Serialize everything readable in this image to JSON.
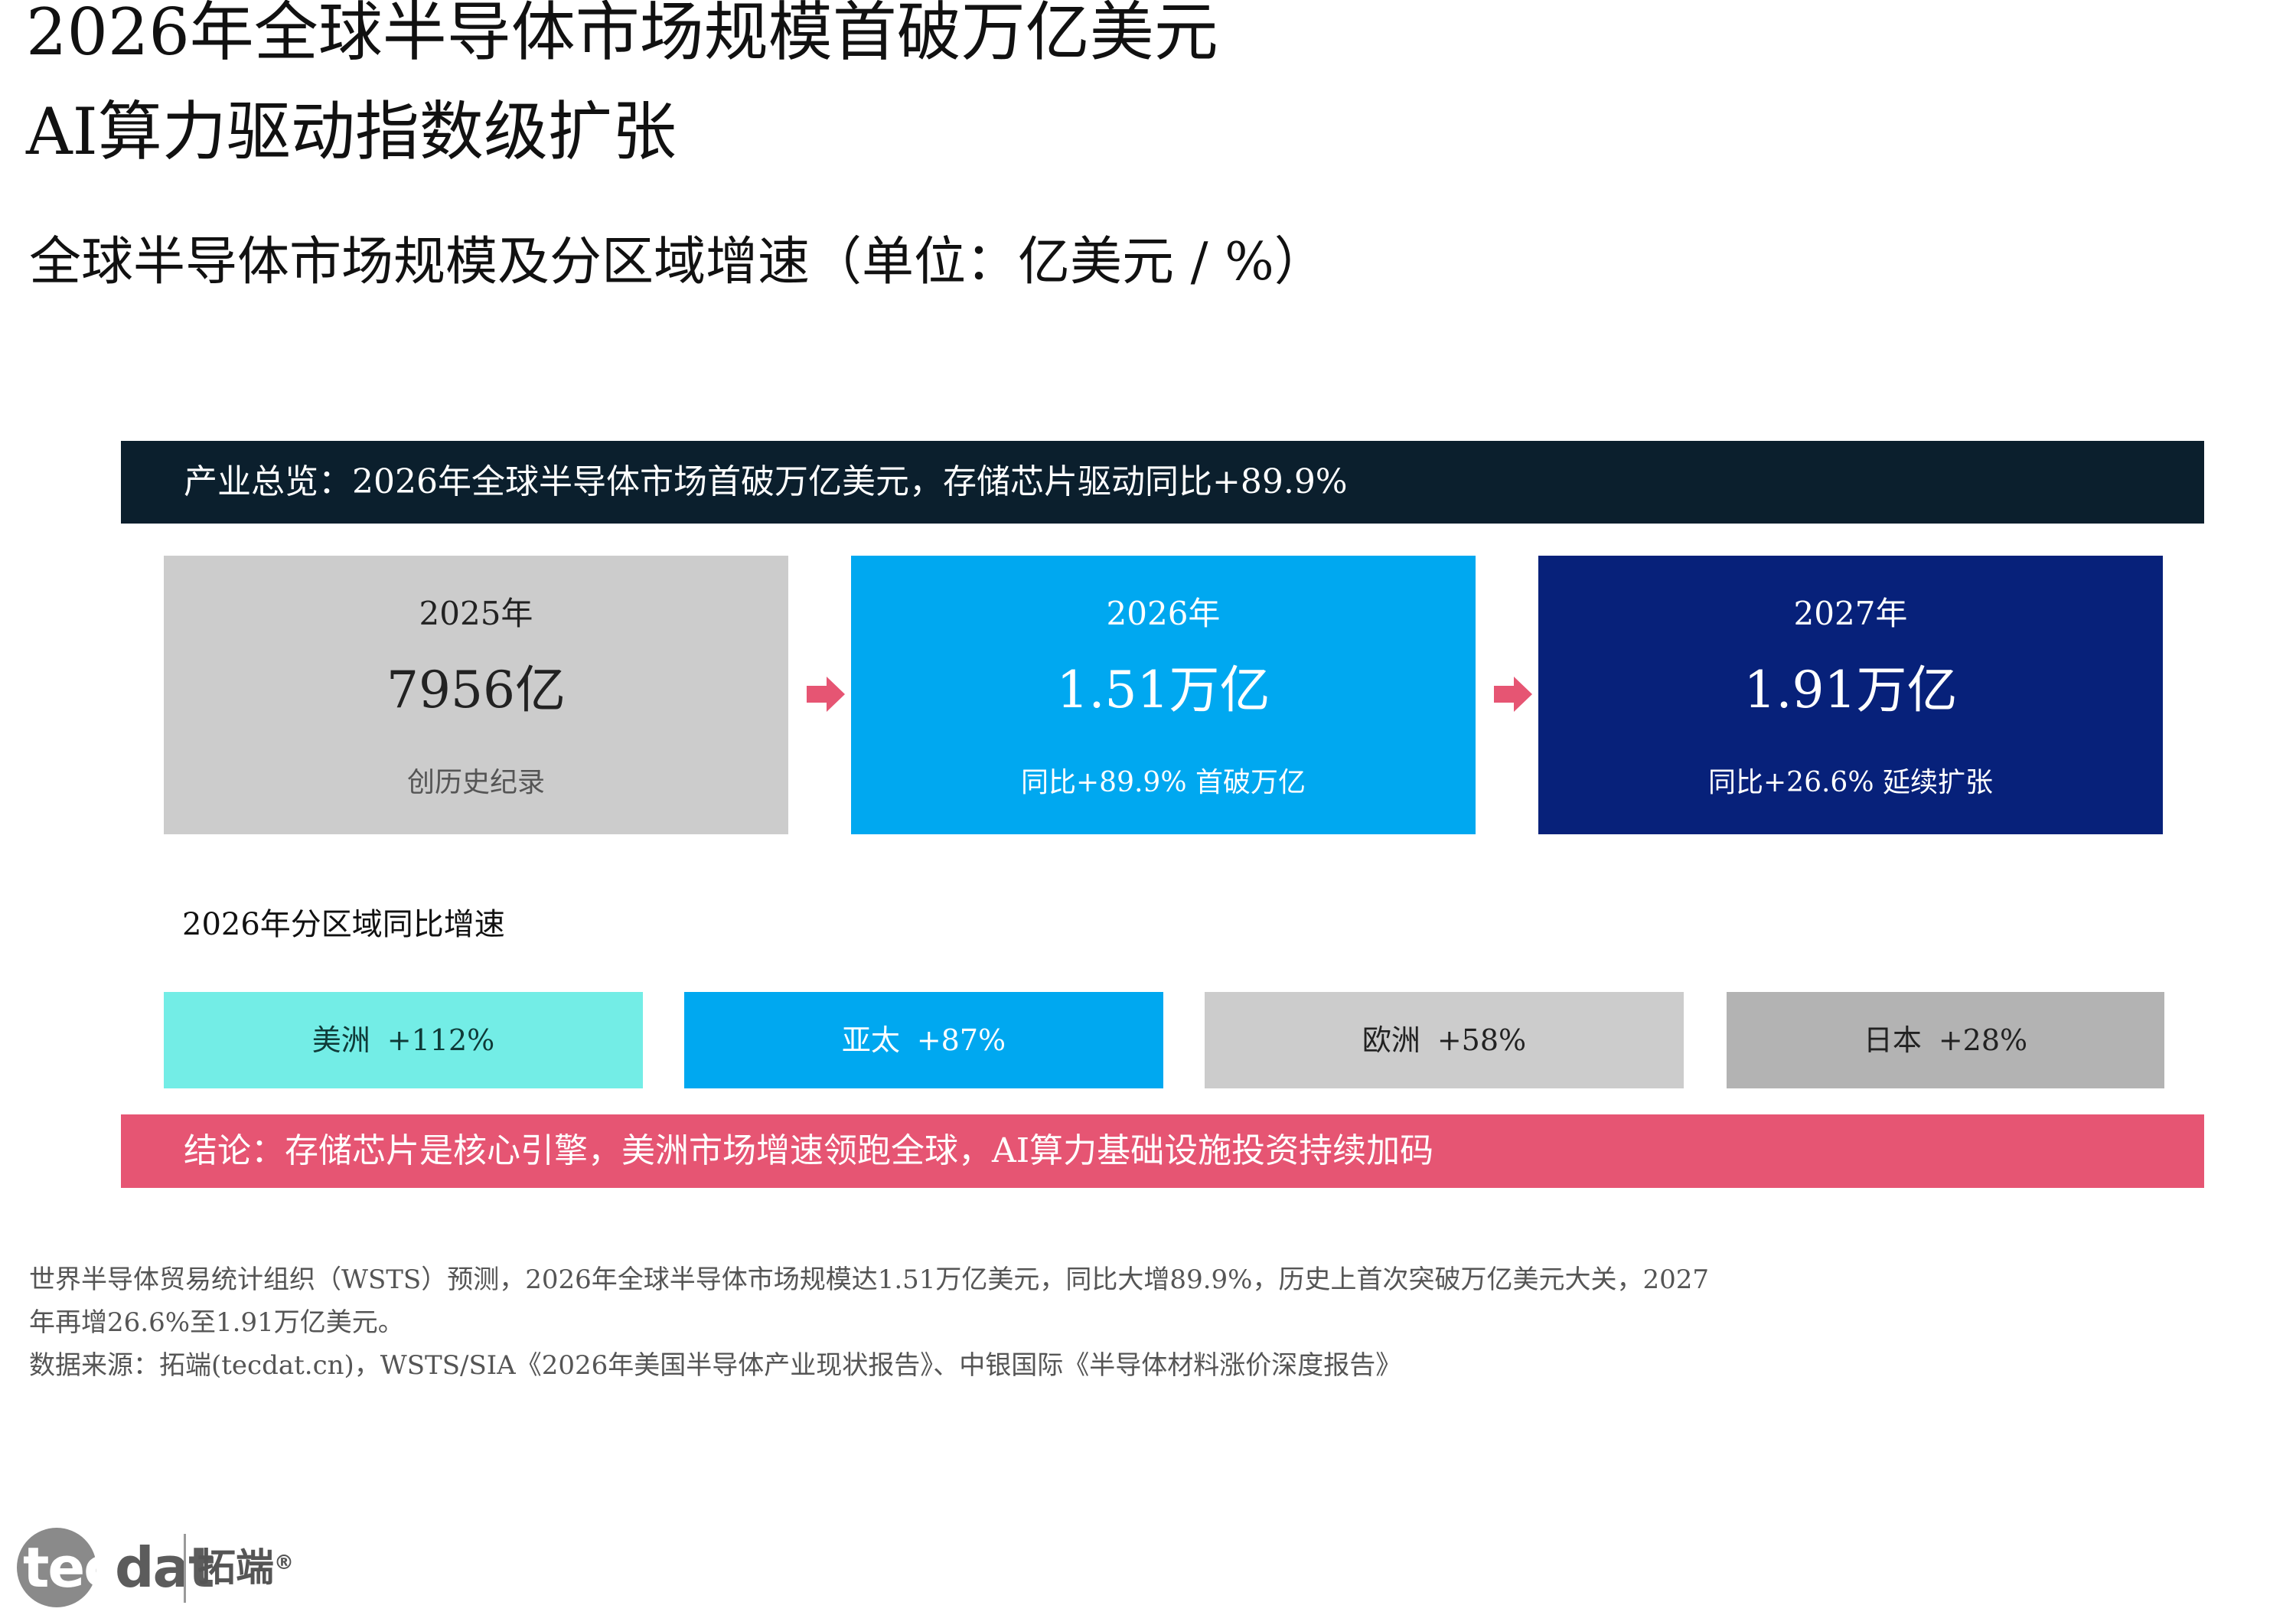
{
  "header": {
    "title_line1": "2026年全球半导体市场规模首破万亿美元",
    "title_line2": "AI算力驱动指数级扩张",
    "subtitle": "全球半导体市场规模及分区域增速（单位：亿美元 / %）"
  },
  "overview": {
    "text": "产业总览：2026年全球半导体市场首破万亿美元，存储芯片驱动同比+89.9%"
  },
  "year_cards": [
    {
      "year": "2025年",
      "value": "7956亿",
      "note": "创历史纪录",
      "color": "#cccccc"
    },
    {
      "year": "2026年",
      "value": "1.51万亿",
      "note": "同比+89.9% 首破万亿",
      "color": "#00a8f0"
    },
    {
      "year": "2027年",
      "value": "1.91万亿",
      "note": "同比+26.6% 延续扩张",
      "color": "#07217a"
    }
  ],
  "arrows": {
    "icon": "arrow-right-icon",
    "color": "#e65573"
  },
  "regions": {
    "heading": "2026年分区域同比增速",
    "items": [
      {
        "name": "美洲",
        "growth": "+112%",
        "color": "#73ede6"
      },
      {
        "name": "亚太",
        "growth": "+87%",
        "color": "#00a8f0"
      },
      {
        "name": "欧洲",
        "growth": "+58%",
        "color": "#cccccc"
      },
      {
        "name": "日本",
        "growth": "+28%",
        "color": "#b3b3b3"
      }
    ]
  },
  "conclusion": {
    "text": "结论：存储芯片是核心引擎，美洲市场增速领跑全球，AI算力基础设施投资持续加码"
  },
  "footnote": {
    "line1": "世界半导体贸易统计组织（WSTS）预测，2026年全球半导体市场规模达1.51万亿美元，同比大增89.9%，历史上首次突破万亿美元大关，2027",
    "line2": "年再增26.6%至1.91万亿美元。",
    "source": "数据来源：拓端(tecdat.cn)，WSTS/SIA《2026年美国半导体产业现状报告》、中银国际《半导体材料涨价深度报告》"
  },
  "logo": {
    "word_light": "tec",
    "word_dark": "dat",
    "cn": "拓端",
    "mark": "®"
  }
}
